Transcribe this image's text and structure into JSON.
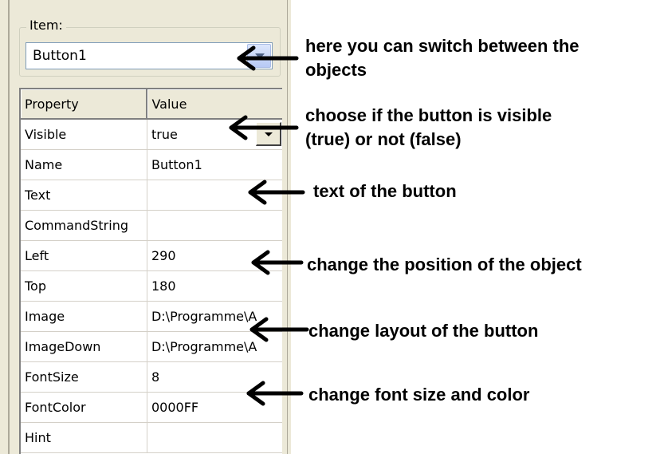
{
  "item_group": {
    "legend": "Item:",
    "selected_value": "Button1",
    "dropdown_icon": "chevron-down-icon"
  },
  "grid": {
    "headers": {
      "property": "Property",
      "value": "Value"
    },
    "rows": [
      {
        "property": "Visible",
        "value": "true"
      },
      {
        "property": "Name",
        "value": "Button1"
      },
      {
        "property": "Text",
        "value": ""
      },
      {
        "property": "CommandString",
        "value": ""
      },
      {
        "property": "Left",
        "value": "290"
      },
      {
        "property": "Top",
        "value": "180"
      },
      {
        "property": "Image",
        "value": "D:\\Programme\\A"
      },
      {
        "property": "ImageDown",
        "value": "D:\\Programme\\A"
      },
      {
        "property": "FontSize",
        "value": "8"
      },
      {
        "property": "FontColor",
        "value": "0000FF"
      },
      {
        "property": "Hint",
        "value": ""
      }
    ]
  },
  "annotations": {
    "switch_objects_line1": "here you can switch between the",
    "switch_objects_line2": "objects",
    "visible_line1": "choose if the button is visible",
    "visible_line2": "(true) or not (false)",
    "text": "text of the button",
    "position": "change the position of the object",
    "layout": "change layout of the button",
    "font": "change font size and color"
  },
  "colors": {
    "panel_background": "#ECE9D8",
    "combo_border": "#7f9db9",
    "arrow": "#000000"
  }
}
